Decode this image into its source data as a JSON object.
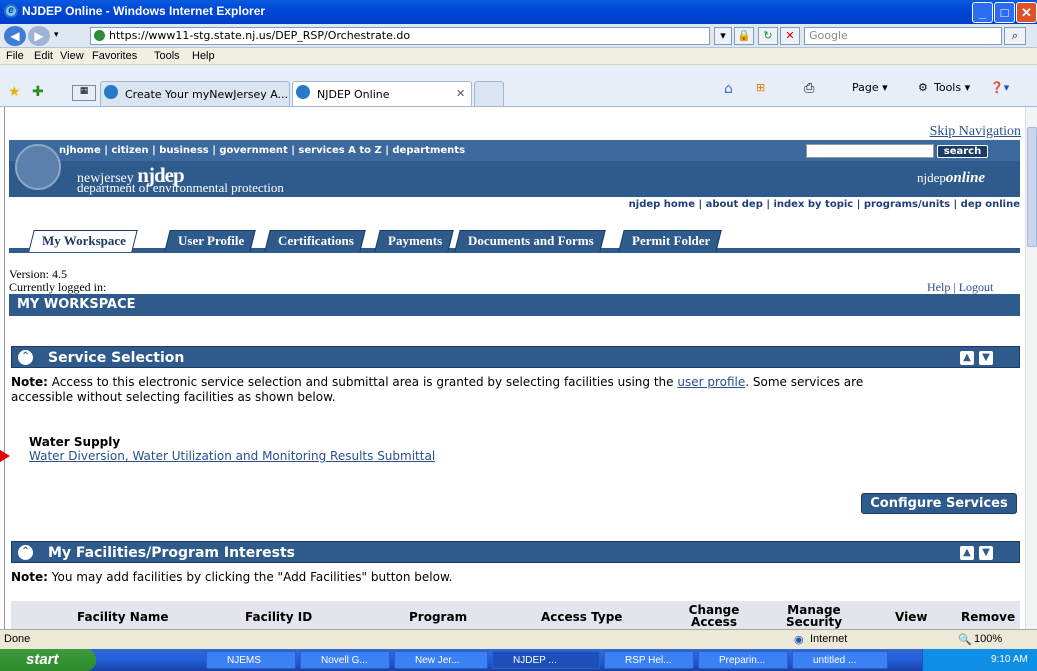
{
  "window": {
    "title": "NJDEP Online - Windows Internet Explorer"
  },
  "address_bar": {
    "url": "https://www11-stg.state.nj.us/DEP_RSP/Orchestrate.do",
    "search_placeholder": "Google"
  },
  "menu": [
    "File",
    "Edit",
    "View",
    "Favorites",
    "Tools",
    "Help"
  ],
  "browser_tabs": [
    {
      "label": "Create Your myNewJersey A..."
    },
    {
      "label": "NJDEP Online"
    }
  ],
  "toolbar": {
    "page": "Page",
    "tools": "Tools"
  },
  "site": {
    "skip_nav": "Skip Navigation",
    "top_links": "njhome  |  citizen  |  business  |  government  |  services A to Z  |  departments",
    "search_btn": "search",
    "logo_small": "newjersey",
    "logo_big": "njdep",
    "logo_sub": "department of environmental protection",
    "online_prefix": "njdep",
    "online_suffix": "online",
    "sub_links": "njdep home  |  about dep  |  index by topic  |  programs/units  |  dep online"
  },
  "tabs": [
    "My Workspace",
    "User Profile",
    "Certifications",
    "Payments",
    "Documents and Forms",
    "Permit Folder"
  ],
  "version": "Version: 4.5",
  "logged_in": "Currently logged in:",
  "help_logout": "Help | Logout",
  "workspace_title": "MY WORKSPACE",
  "service_selection": {
    "title": "Service Selection",
    "note_label": "Note:",
    "note_text1": "Access to this electronic service selection and submittal area is granted by selecting facilities using the",
    "note_link": "user profile",
    "note_text2": ". Some services are",
    "note_text3": "accessible without selecting facilities as shown below.",
    "group": "Water Supply",
    "link": "Water Diversion, Water Utilization and Monitoring Results Submittal",
    "configure": "Configure Services"
  },
  "facilities": {
    "title": "My Facilities/Program Interests",
    "note_label": "Note:",
    "note_text": "You may add facilities by clicking the \"Add Facilities\" button below.",
    "columns": [
      "Facility Name",
      "Facility ID",
      "Program",
      "Access Type",
      "Change Access",
      "Manage Security",
      "View",
      "Remove"
    ]
  },
  "status": {
    "left": "Done",
    "zone": "Internet",
    "zoom": "100%"
  },
  "taskbar": {
    "start": "start",
    "tasks": [
      "NJEMS",
      "Novell G...",
      "New Jer...",
      "NJDEP ...",
      "RSP Hel...",
      "Preparin...",
      "untitled ..."
    ],
    "time": "9:10 AM"
  }
}
